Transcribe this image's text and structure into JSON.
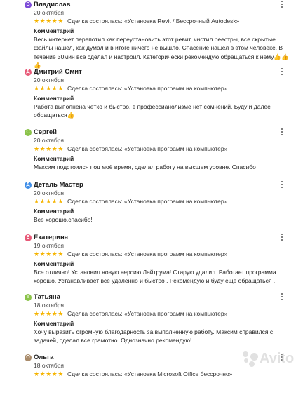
{
  "comment_label": "Комментарий",
  "stars": "★★★★★",
  "reviews": [
    {
      "initial": "В",
      "avatar_color": "#7d4bd8",
      "name": "Владислав",
      "date": "20 октября",
      "deal": "Сделка состоялась: «Установка Revit / Бессрочный Autodesk»",
      "text": "Весь интернет перепотил как переустановить этот ревит, чистил реестры, все скрытые файлы нашел, как думал и в итоге ничего не вышло. Спасение нашел в этом человеке. В течение 30мин все сделал и настроил. Категорически рекомендую обращаться к нему👍👍👍"
    },
    {
      "initial": "Д",
      "avatar_color": "#e85a78",
      "name": "Дмитрий Смит",
      "date": "20 октября",
      "deal": "Сделка состоялась: «Установка программ на компьютер»",
      "text": "Работа выполнена чётко и быстро, в профессианолизме нет сомнений. Буду и далее обращаться👍"
    },
    {
      "initial": "С",
      "avatar_color": "#8bc34a",
      "name": "Сергей",
      "date": "20 октября",
      "deal": "Сделка состоялась: «Установка программ на компьютер»",
      "text": "Максим подстоился под моё время, сделал работу на высшем уровне. Спасибо"
    },
    {
      "initial": "Д",
      "avatar_color": "#3f8ee8",
      "name": "Деталь Мастер",
      "date": "20 октября",
      "deal": "Сделка состоялась: «Установка программ на компьютер»",
      "text": "Все хорошо,спасибо!"
    },
    {
      "initial": "Е",
      "avatar_color": "#e85a78",
      "name": "Екатерина",
      "date": "19 октября",
      "deal": "Сделка состоялась: «Установка программ на компьютер»",
      "text": "Все отлично! Установил новую версию Лайтрума! Старую удалил. Работает программа хорошо. Устанавливает все удаленно и быстро . Рекомендую и буду еще обращаться ."
    },
    {
      "initial": "Т",
      "avatar_color": "#8bc34a",
      "name": "Татьяна",
      "date": "18 октября",
      "deal": "Сделка состоялась: «Установка программ на компьютер»",
      "text": "Хочу выразить огромную благодарность за выполненную работу. Максим справился с задачей, сделал все грамотно. Однозначно рекомендую!"
    },
    {
      "initial": "О",
      "avatar_color": "#a98b6a",
      "name": "Ольга",
      "date": "18 октября",
      "deal": "Сделка состоялась: «Установка Microsoft Office бессрочно»",
      "text": ""
    }
  ],
  "watermark": "Avito"
}
